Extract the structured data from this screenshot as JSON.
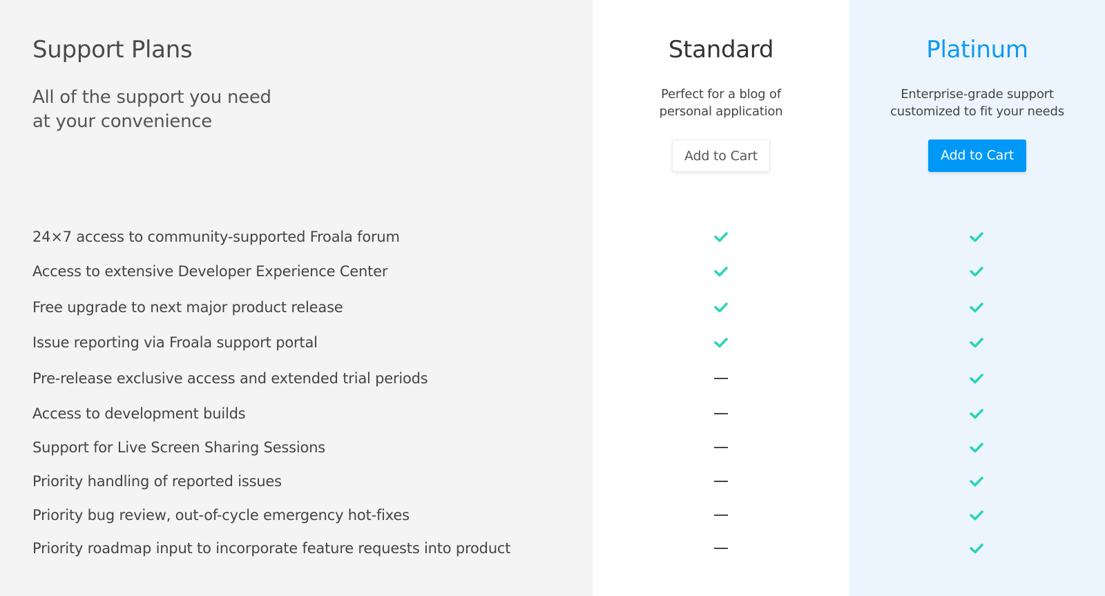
{
  "header": {
    "title": "Support Plans",
    "subtitle_line1": "All of the support you need",
    "subtitle_line2": "at your convenience"
  },
  "plans": [
    {
      "name": "Standard",
      "desc_line1": "Perfect for a blog of",
      "desc_line2": "personal application",
      "button_label": "Add to Cart"
    },
    {
      "name": "Platinum",
      "desc_line1": "Enterprise-grade support",
      "desc_line2": "customized to fit your needs",
      "button_label": "Add to Cart",
      "highlighted": true
    }
  ],
  "features": [
    {
      "label": "24×7 access to community-supported Froala forum",
      "standard": "check",
      "platinum": "check"
    },
    {
      "label": "Access to extensive Developer Experience Center",
      "standard": "check",
      "platinum": "check"
    },
    {
      "label": "Free upgrade to next major product release",
      "standard": "check",
      "platinum": "check"
    },
    {
      "label": "Issue reporting via Froala support portal",
      "standard": "check",
      "platinum": "check"
    },
    {
      "label": "Pre-release exclusive access and extended trial periods",
      "standard": "dash",
      "platinum": "check"
    },
    {
      "label": "Access to development builds",
      "standard": "dash",
      "platinum": "check"
    },
    {
      "label": "Support for Live Screen Sharing Sessions",
      "standard": "dash",
      "platinum": "check"
    },
    {
      "label": "Priority handling of reported issues",
      "standard": "dash",
      "platinum": "check"
    },
    {
      "label": "Priority bug review, out-of-cycle emergency hot-fixes",
      "standard": "dash",
      "platinum": "check"
    },
    {
      "label": "Priority roadmap input to incorporate feature requests into product",
      "standard": "dash",
      "platinum": "check"
    }
  ],
  "colors": {
    "check": "#2ed3b7",
    "accent": "#0098f7",
    "platinum_bg": "#ecf5fe",
    "left_bg": "#f4f4f4"
  }
}
